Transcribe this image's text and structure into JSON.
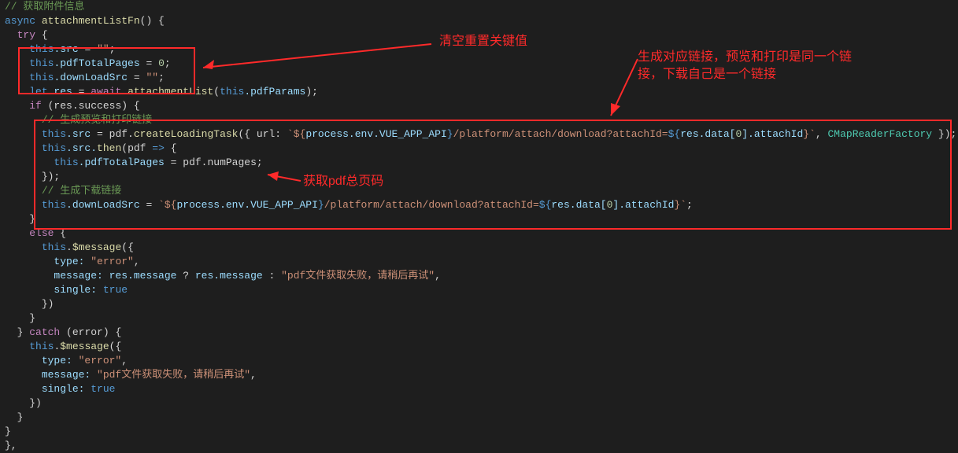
{
  "code": {
    "l1": "// 获取附件信息",
    "l2a": "async",
    "l2b": "attachmentListFn",
    "l2c": "() {",
    "l3a": "try",
    "l3b": " {",
    "l4a": "this",
    "l4b": ".src",
    "l4c": " = ",
    "l4d": "\"\"",
    "l4e": ";",
    "l5a": "this",
    "l5b": ".pdfTotalPages",
    "l5c": " = ",
    "l5d": "0",
    "l5e": ";",
    "l6a": "this",
    "l6b": ".downLoadSrc",
    "l6c": " = ",
    "l6d": "\"\"",
    "l6e": ";",
    "l7a": "let",
    "l7b": " res ",
    "l7c": "= ",
    "l7d": "await",
    "l7e": " attachmentList",
    "l7f": "(",
    "l7g": "this",
    "l7h": ".pdfParams",
    "l7i": ");",
    "l8a": "if",
    "l8b": " (res.success) {",
    "l9": "// 生成预览和打印链接",
    "l10a": "this",
    "l10b": ".src",
    "l10c": " = pdf.",
    "l10d": "createLoadingTask",
    "l10e": "({ url: ",
    "l10f": "`${",
    "l10g": "process.env.VUE_APP_API",
    "l10h": "}",
    "l10i": "/platform/attach/download?attachId=",
    "l10j": "${",
    "l10k": "res.data[",
    "l10l": "0",
    "l10m": "].attachId",
    "l10n": "}`",
    "l10o": ", ",
    "l10p": "CMapReaderFactory",
    "l10q": " });",
    "l11a": "this",
    "l11b": ".src.",
    "l11c": "then",
    "l11d": "(pdf ",
    "l11e": "=>",
    "l11f": " {",
    "l12a": "this",
    "l12b": ".pdfTotalPages",
    "l12c": " = pdf.numPages;",
    "l13": "});",
    "l14": "// 生成下载链接",
    "l15a": "this",
    "l15b": ".downLoadSrc",
    "l15c": " = ",
    "l15d": "`${",
    "l15e": "process.env.VUE_APP_API",
    "l15f": "}",
    "l15g": "/platform/attach/download?attachId=",
    "l15h": "${",
    "l15i": "res.data[",
    "l15j": "0",
    "l15k": "].attachId",
    "l15l": "}`",
    "l15m": ";",
    "l16": "}",
    "l17a": "else",
    "l17b": " {",
    "l18a": "this",
    "l18b": ".",
    "l18c": "$message",
    "l18d": "({",
    "l19a": "type: ",
    "l19b": "\"error\"",
    "l19c": ",",
    "l20a": "message: res.message ",
    "l20b": "?",
    "l20c": " res.message ",
    "l20d": ":",
    "l20e": " \"pdf文件获取失败，请稍后再试\"",
    "l20f": ",",
    "l21a": "single: ",
    "l21b": "true",
    "l22": "})",
    "l23": "}",
    "l24a": "} ",
    "l24b": "catch",
    "l24c": " (error) {",
    "l25a": "this",
    "l25b": ".",
    "l25c": "$message",
    "l25d": "({",
    "l26a": "type: ",
    "l26b": "\"error\"",
    "l26c": ",",
    "l27a": "message: ",
    "l27b": "\"pdf文件获取失败，请稍后再试\"",
    "l27c": ",",
    "l28a": "single: ",
    "l28b": "true",
    "l29": "})",
    "l30": "}",
    "l31": "}",
    "l32": "},"
  },
  "anno": {
    "a1": "清空重置关键值",
    "a2_line1": "生成对应链接，预览和打印是同一个链",
    "a2_line2": "接，下载自己是一个链接",
    "a3": "获取pdf总页码"
  }
}
